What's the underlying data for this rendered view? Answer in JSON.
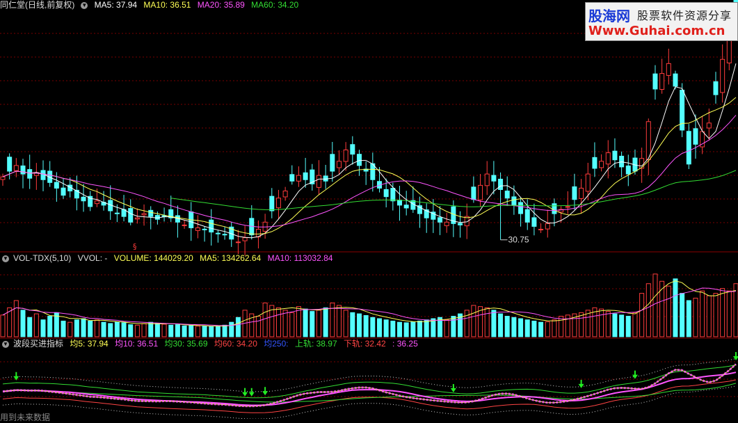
{
  "price_panel": {
    "title": "同仁堂(日线,前复权)",
    "ma5": "MA5: 37.94",
    "ma10": "MA10: 36.51",
    "ma20": "MA20: 35.89",
    "ma60": "MA60: 34.20",
    "low_label": "30.75",
    "marker": "§"
  },
  "volume_panel": {
    "title": "VOL-TDX(5,10)",
    "vvol": "VVOL: -",
    "volume": "VOLUME: 144029.20",
    "ma5": "MA5: 134262.64",
    "ma10": "MA10: 113032.84"
  },
  "wave_panel": {
    "title": "波段买进指标",
    "j5": "均5: 37.94",
    "j10": "均10: 36.51",
    "j30": "均30: 35.69",
    "j60": "均60: 34.20",
    "j250": "均250:",
    "upper": "上轨: 38.97",
    "lower": "下轨: 32.42",
    "mid": ": 36.25"
  },
  "logo": {
    "brand": "股海网",
    "slogan": "股票软件资源分享",
    "url": "Www.Guhai.com.cn"
  },
  "bottom_note": "用到未来数据",
  "colors": {
    "up": "#ff3c3c",
    "down": "#54ffff",
    "ma5": "#ffffff",
    "ma10": "#ffff55",
    "ma20": "#ff55ff",
    "ma60": "#33dd33",
    "grid": "#7a0000"
  },
  "chart_data": {
    "type": "candlestick",
    "price_ylim": [
      30,
      47
    ],
    "annotation": {
      "x": 74,
      "value": 30.75
    },
    "close": [
      35.2,
      35.6,
      36.0,
      35.4,
      35.1,
      35.5,
      35.0,
      34.8,
      34.4,
      33.9,
      34.2,
      33.7,
      33.5,
      33.1,
      33.5,
      33.2,
      32.8,
      32.6,
      32.4,
      32.0,
      32.3,
      32.6,
      32.4,
      32.2,
      32.4,
      32.3,
      32.0,
      31.8,
      31.6,
      31.6,
      31.5,
      31.3,
      31.2,
      31.1,
      30.8,
      30.6,
      30.9,
      31.1,
      31.5,
      32.0,
      32.8,
      33.7,
      34.2,
      34.9,
      35.3,
      35.0,
      34.7,
      35.3,
      34.9,
      35.6,
      36.3,
      37.1,
      36.8,
      36.0,
      35.6,
      35.0,
      34.4,
      33.8,
      33.5,
      33.2,
      33.0,
      32.9,
      32.6,
      32.3,
      32.2,
      32.0,
      32.0,
      31.9,
      31.8,
      32.4,
      33.6,
      34.6,
      35.4,
      34.9,
      34.3,
      33.7,
      33.2,
      32.6,
      32.0,
      31.7,
      31.5,
      31.9,
      32.6,
      32.9,
      33.1,
      33.6,
      34.4,
      35.4,
      35.8,
      36.3,
      36.9,
      36.4,
      35.9,
      35.4,
      35.6,
      36.5,
      39.1,
      41.4,
      42.5,
      43.2,
      41.6,
      38.5,
      36.1,
      37.5,
      38.4,
      39.0,
      41.0,
      43.5,
      45.3,
      47.2
    ],
    "volume_ylim": [
      0,
      300000
    ],
    "volume": [
      90000,
      120000,
      150000,
      110000,
      80000,
      95000,
      70000,
      85000,
      100000,
      65000,
      60000,
      70000,
      75000,
      65000,
      70000,
      60000,
      55000,
      62000,
      58000,
      50000,
      48000,
      54000,
      60000,
      55000,
      52000,
      48000,
      50000,
      45000,
      47000,
      44000,
      43000,
      42000,
      44000,
      48000,
      60000,
      80000,
      110000,
      95000,
      85000,
      140000,
      130000,
      120000,
      110000,
      100000,
      125000,
      115000,
      105000,
      110000,
      120000,
      140000,
      130000,
      110000,
      100000,
      95000,
      88000,
      80000,
      75000,
      70000,
      65000,
      60000,
      58000,
      62000,
      65000,
      70000,
      75000,
      80000,
      70000,
      85000,
      95000,
      110000,
      130000,
      125000,
      120000,
      110000,
      95000,
      85000,
      80000,
      75000,
      70000,
      65000,
      60000,
      62000,
      70000,
      85000,
      90000,
      95000,
      100000,
      110000,
      120000,
      115000,
      105000,
      95000,
      90000,
      85000,
      100000,
      180000,
      220000,
      260000,
      230000,
      210000,
      240000,
      180000,
      150000,
      160000,
      190000,
      170000,
      180000,
      200000,
      190000,
      220000
    ],
    "wave_ylim": [
      28,
      48
    ],
    "buy_signal_index": [
      2,
      36,
      37,
      39,
      67,
      86,
      94,
      109
    ]
  }
}
